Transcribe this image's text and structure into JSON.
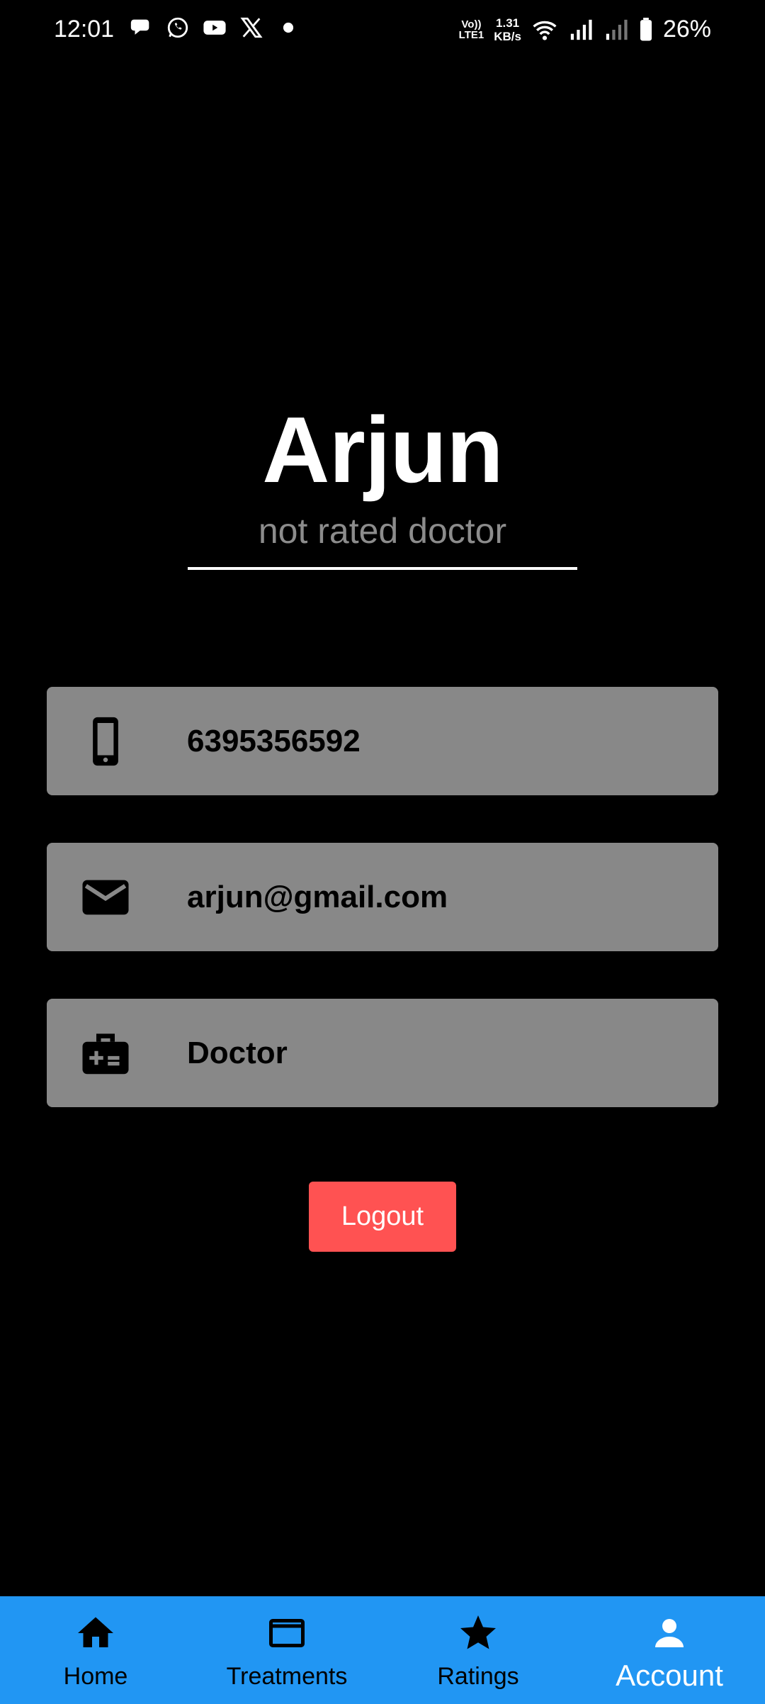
{
  "status_bar": {
    "time": "12:01",
    "left_icons": [
      "chat-bubble-icon",
      "whatsapp-icon",
      "youtube-icon",
      "x-icon",
      "dot-icon"
    ],
    "volte_line1": "Vo))",
    "volte_line2": "LTE1",
    "net_speed_value": "1.31",
    "net_speed_unit": "KB/s",
    "battery_percent": "26%"
  },
  "profile": {
    "name": "Arjun",
    "subtitle": "not rated doctor"
  },
  "info_cards": [
    {
      "icon": "phone-icon",
      "value": "6395356592"
    },
    {
      "icon": "mail-icon",
      "value": "arjun@gmail.com"
    },
    {
      "icon": "medical-bag-icon",
      "value": "Doctor"
    }
  ],
  "logout_label": "Logout",
  "bottom_nav": [
    {
      "label": "Home",
      "icon": "home-icon"
    },
    {
      "label": "Treatments",
      "icon": "credit-card-icon"
    },
    {
      "label": "Ratings",
      "icon": "star-icon"
    },
    {
      "label": "Account",
      "icon": "person-icon",
      "active": true
    }
  ],
  "colors": {
    "background": "#000000",
    "card": "#888888",
    "logout": "#ff5252",
    "nav": "#2196f3"
  }
}
